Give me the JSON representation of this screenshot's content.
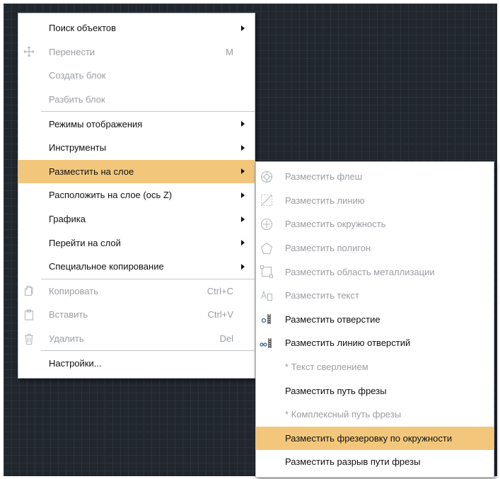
{
  "main_menu": {
    "items": [
      {
        "label": "Поиск объектов",
        "submenu": true
      },
      {
        "label": "Перенести",
        "shortcut": "M",
        "icon": "move-arrows-icon"
      },
      {
        "label": "Создать блок"
      },
      {
        "label": "Разбить блок"
      },
      {
        "label": "Режимы отображения",
        "submenu": true
      },
      {
        "label": "Инструменты",
        "submenu": true
      },
      {
        "label": "Разместить на слое",
        "submenu": true
      },
      {
        "label": "Расположить на слое (ось Z)",
        "submenu": true
      },
      {
        "label": "Графика",
        "submenu": true
      },
      {
        "label": "Перейти на слой",
        "submenu": true
      },
      {
        "label": "Специальное копирование",
        "submenu": true
      },
      {
        "label": "Копировать",
        "shortcut": "Ctrl+C",
        "icon": "copy-icon"
      },
      {
        "label": "Вставить",
        "shortcut": "Ctrl+V",
        "icon": "paste-icon"
      },
      {
        "label": "Удалить",
        "shortcut": "Del",
        "icon": "trash-icon"
      },
      {
        "label": "Настройки..."
      }
    ]
  },
  "sub_menu": {
    "items": [
      {
        "label": "Разместить флеш",
        "icon": "flash-pad-icon"
      },
      {
        "label": "Разместить линию",
        "icon": "line-icon"
      },
      {
        "label": "Разместить окружность",
        "icon": "circle-icon"
      },
      {
        "label": "Разместить полигон",
        "icon": "polygon-icon"
      },
      {
        "label": "Разместить область металлизации",
        "icon": "metal-area-icon"
      },
      {
        "label": "Разместить текст",
        "icon": "text-icon"
      },
      {
        "label": "Разместить отверстие",
        "icon": "hole-icon"
      },
      {
        "label": "Разместить линию отверстий",
        "icon": "hole-line-icon"
      },
      {
        "label": "* Текст сверлением"
      },
      {
        "label": "Разместить путь фрезы"
      },
      {
        "label": "* Комплексный путь фрезы"
      },
      {
        "label": "Разместить фрезеровку по окружности"
      },
      {
        "label": "Разместить разрыв пути фрезы"
      }
    ]
  },
  "colors": {
    "highlight": "#f2c77c",
    "canvas": "#22272e",
    "disabled_text": "#9a9da2"
  }
}
